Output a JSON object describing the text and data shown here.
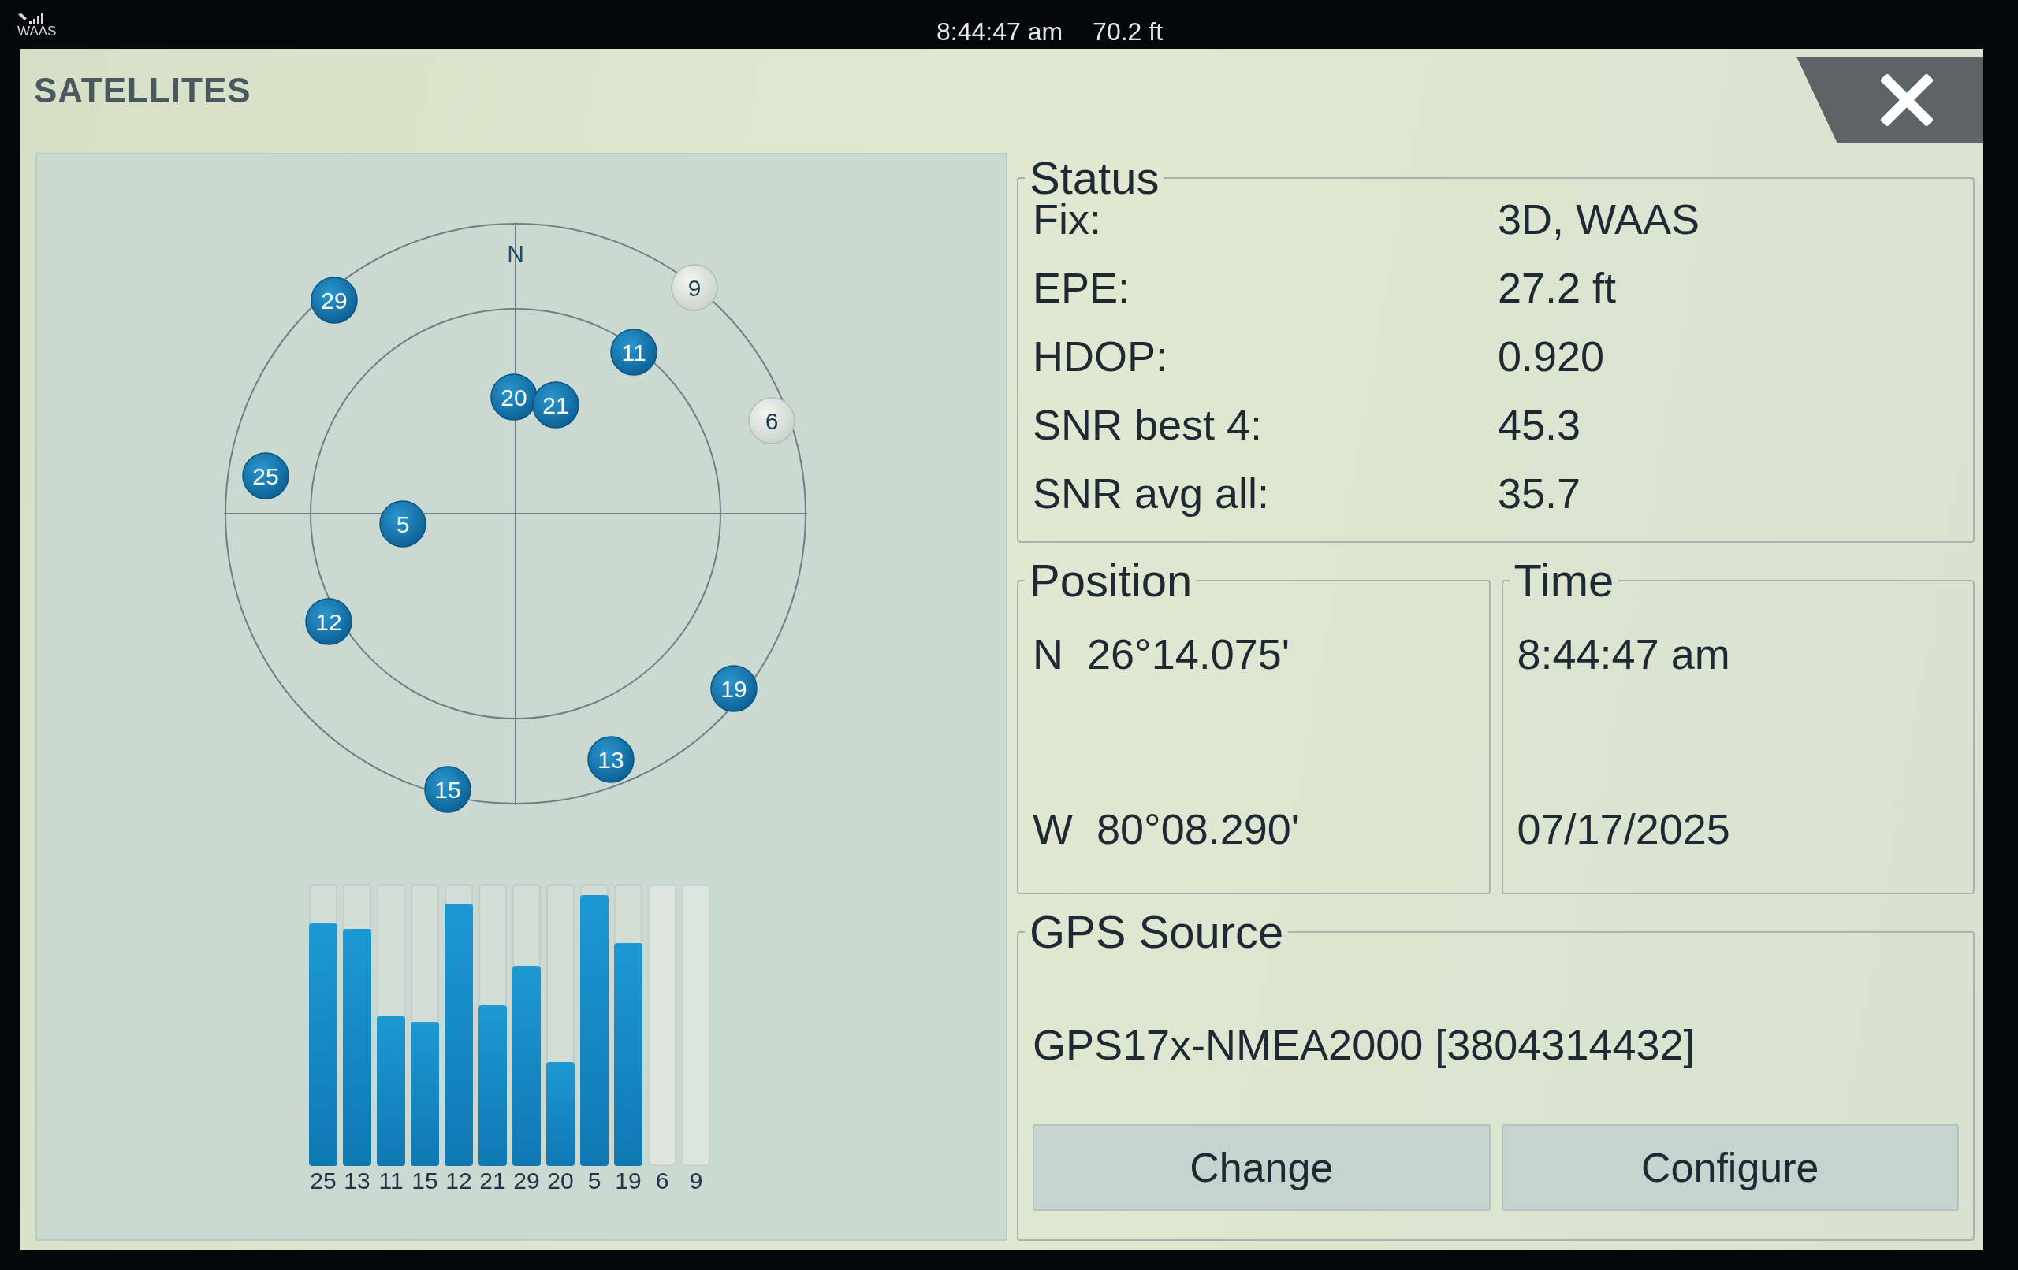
{
  "status_bar": {
    "gps_label": "WAAS",
    "time": "8:44:47 am",
    "depth": "70.2 ft"
  },
  "window": {
    "title": "SATELLITES"
  },
  "sky_plot": {
    "north_label": "N",
    "satellites": [
      {
        "number": "29",
        "tracked": true
      },
      {
        "number": "9",
        "tracked": false
      },
      {
        "number": "11",
        "tracked": true
      },
      {
        "number": "20",
        "tracked": true
      },
      {
        "number": "21",
        "tracked": true
      },
      {
        "number": "6",
        "tracked": false
      },
      {
        "number": "25",
        "tracked": true
      },
      {
        "number": "5",
        "tracked": true
      },
      {
        "number": "12",
        "tracked": true
      },
      {
        "number": "19",
        "tracked": true
      },
      {
        "number": "13",
        "tracked": true
      },
      {
        "number": "15",
        "tracked": true
      }
    ]
  },
  "signal_bars": [
    {
      "label": "25",
      "level": 0.86
    },
    {
      "label": "13",
      "level": 0.84
    },
    {
      "label": "11",
      "level": 0.53
    },
    {
      "label": "15",
      "level": 0.51
    },
    {
      "label": "12",
      "level": 0.93
    },
    {
      "label": "21",
      "level": 0.57
    },
    {
      "label": "29",
      "level": 0.71
    },
    {
      "label": "20",
      "level": 0.37
    },
    {
      "label": "5",
      "level": 0.96
    },
    {
      "label": "19",
      "level": 0.79
    },
    {
      "label": "6",
      "kind": "no_signal"
    },
    {
      "label": "9",
      "kind": "no_signal"
    }
  ],
  "status": {
    "title": "Status",
    "rows": [
      {
        "label": "Fix:",
        "value": "3D, WAAS"
      },
      {
        "label": "EPE:",
        "value": "27.2 ft"
      },
      {
        "label": "HDOP:",
        "value": "0.920"
      },
      {
        "label": "SNR best 4:",
        "value": "45.3"
      },
      {
        "label": "SNR avg all:",
        "value": "35.7"
      }
    ]
  },
  "position": {
    "title": "Position",
    "latitude": "N  26°14.075'",
    "longitude": "W  80°08.290'"
  },
  "time": {
    "title": "Time",
    "time": "8:44:47 am",
    "date": "07/17/2025"
  },
  "gps_source": {
    "title": "GPS Source",
    "device": "GPS17x-NMEA2000 [3804314432]",
    "buttons": [
      "Change",
      "Configure"
    ]
  }
}
